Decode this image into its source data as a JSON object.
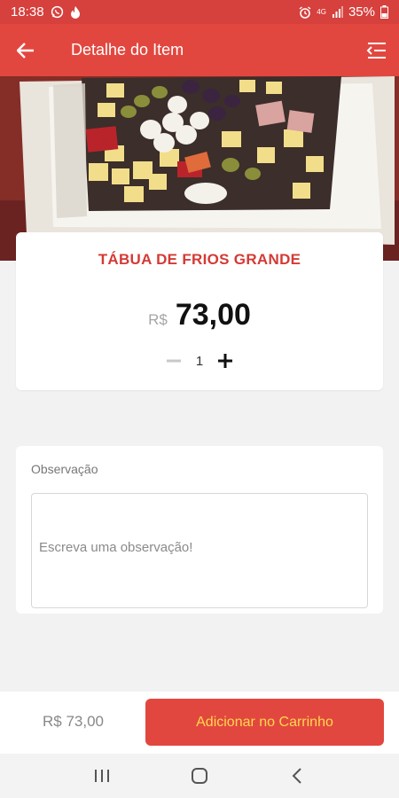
{
  "status_bar": {
    "time": "18:38",
    "battery": "35%",
    "network": "4G",
    "left_icons": [
      "whatsapp-icon",
      "fire-icon"
    ],
    "right_icons": [
      "alarm-icon",
      "network-icon",
      "signal-icon",
      "battery-icon"
    ]
  },
  "app_bar": {
    "title": "Detalhe do Item",
    "back_icon": "arrow-left-icon",
    "menu_icon": "menu-collapse-icon"
  },
  "item": {
    "name": "TÁBUA DE FRIOS GRANDE",
    "currency": "R$",
    "price": "73,00",
    "quantity": "1"
  },
  "observation": {
    "label": "Observação",
    "placeholder": "Escreva uma observação!",
    "value": ""
  },
  "footer": {
    "total": "R$ 73,00",
    "add_button_label": "Adicionar no Carrinho"
  },
  "colors": {
    "primary": "#e2473f",
    "status_bar": "#d6403d",
    "title_red": "#d43a36",
    "button_text": "#ffd84d"
  },
  "nav_bar": {
    "items": [
      "recent-apps-icon",
      "home-icon",
      "back-icon"
    ]
  }
}
